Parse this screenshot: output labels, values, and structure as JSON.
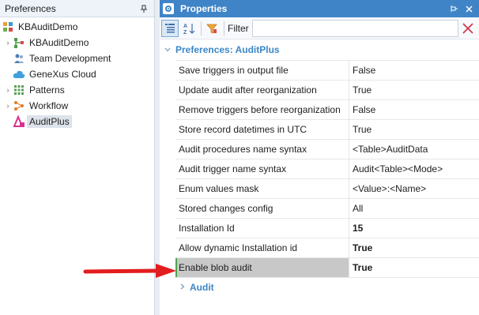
{
  "left_pane": {
    "title": "Preferences",
    "pin_glyph": "ᴥ",
    "tree": [
      {
        "label": "KBAuditDemo",
        "icon": "kb-cube-icon",
        "level": 0,
        "expander": ""
      },
      {
        "label": "KBAuditDemo",
        "icon": "version-tree-icon",
        "level": 1,
        "expander": "›"
      },
      {
        "label": "Team Development",
        "icon": "team-development-icon",
        "level": 1,
        "expander": ""
      },
      {
        "label": "GeneXus Cloud",
        "icon": "cloud-icon",
        "level": 1,
        "expander": ""
      },
      {
        "label": "Patterns",
        "icon": "patterns-grid-icon",
        "level": 1,
        "expander": "›"
      },
      {
        "label": "Workflow",
        "icon": "workflow-icon",
        "level": 1,
        "expander": "›"
      },
      {
        "label": "AuditPlus",
        "icon": "auditplus-icon",
        "level": 1,
        "expander": "",
        "selected": true
      }
    ]
  },
  "properties": {
    "title": "Properties",
    "filter_label": "Filter",
    "filter_value": "",
    "category": "Preferences: AuditPlus",
    "rows": [
      {
        "name": "Save triggers in output file",
        "value": "False",
        "bold": false
      },
      {
        "name": "Update audit after reorganization",
        "value": "True",
        "bold": false
      },
      {
        "name": "Remove triggers before reorganization",
        "value": "False",
        "bold": false
      },
      {
        "name": "Store record datetimes in UTC",
        "value": "True",
        "bold": false
      },
      {
        "name": "Audit procedures name syntax",
        "value": "<Table>AuditData",
        "bold": false
      },
      {
        "name": "Audit trigger name syntax",
        "value": "Audit<Table><Mode>",
        "bold": false
      },
      {
        "name": "Enum values mask",
        "value": "<Value>:<Name>",
        "bold": false
      },
      {
        "name": "Stored changes config",
        "value": "All",
        "bold": false
      },
      {
        "name": "Installation Id",
        "value": "15",
        "bold": true
      },
      {
        "name": "Allow dynamic Installation id",
        "value": "True",
        "bold": true
      },
      {
        "name": "Enable blob audit",
        "value": "True",
        "bold": true,
        "selected": true
      }
    ],
    "subcategory": "Audit"
  },
  "colors": {
    "header_blue": "#3f84c7",
    "category_blue": "#3a86c8",
    "arrow_red": "#e31d1d",
    "selected_gray": "#c8c8c8"
  }
}
